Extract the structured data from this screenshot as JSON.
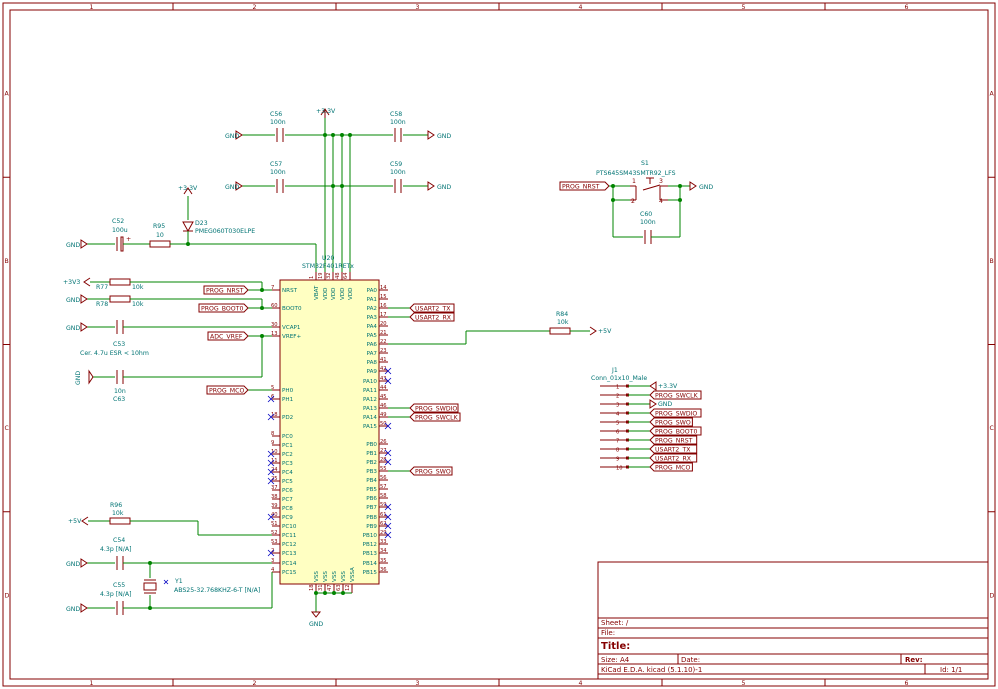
{
  "sheet": {
    "cols": [
      "1",
      "2",
      "3",
      "4",
      "5",
      "6"
    ],
    "rows": [
      "A",
      "B",
      "C",
      "D"
    ]
  },
  "title_block": {
    "sheet_label": "Sheet: /",
    "file_label": "File:",
    "title_label": "Title:",
    "size_label": "Size: A4",
    "date_label": "Date:",
    "rev_label": "Rev:",
    "tool_label": "KiCad E.D.A.  kicad (5.1.10)-1",
    "id_label": "Id: 1/1"
  },
  "mcu": {
    "ref": "U20",
    "value": "STM32F401RETx",
    "left_pins": [
      {
        "num": "7",
        "name": "NRST"
      },
      {
        "num": "60",
        "name": "BOOT0"
      },
      {
        "num": "30",
        "name": "VCAP1"
      },
      {
        "num": "13",
        "name": "VREF+"
      },
      {
        "num": "5",
        "name": "PH0"
      },
      {
        "num": "6",
        "name": "PH1"
      },
      {
        "num": "18",
        "name": "PD2"
      },
      {
        "num": "8",
        "name": "PC0"
      },
      {
        "num": "9",
        "name": "PC1"
      },
      {
        "num": "10",
        "name": "PC2"
      },
      {
        "num": "11",
        "name": "PC3"
      },
      {
        "num": "24",
        "name": "PC4"
      },
      {
        "num": "25",
        "name": "PC5"
      },
      {
        "num": "37",
        "name": "PC6"
      },
      {
        "num": "38",
        "name": "PC7"
      },
      {
        "num": "39",
        "name": "PC8"
      },
      {
        "num": "40",
        "name": "PC9"
      },
      {
        "num": "51",
        "name": "PC10"
      },
      {
        "num": "52",
        "name": "PC11"
      },
      {
        "num": "53",
        "name": "PC12"
      },
      {
        "num": "2",
        "name": "PC13"
      },
      {
        "num": "3",
        "name": "PC14"
      },
      {
        "num": "4",
        "name": "PC15"
      }
    ],
    "right_pins": [
      {
        "num": "14",
        "name": "PA0"
      },
      {
        "num": "15",
        "name": "PA1"
      },
      {
        "num": "16",
        "name": "PA2"
      },
      {
        "num": "17",
        "name": "PA3"
      },
      {
        "num": "20",
        "name": "PA4"
      },
      {
        "num": "21",
        "name": "PA5"
      },
      {
        "num": "22",
        "name": "PA6"
      },
      {
        "num": "23",
        "name": "PA7"
      },
      {
        "num": "41",
        "name": "PA8"
      },
      {
        "num": "42",
        "name": "PA9"
      },
      {
        "num": "43",
        "name": "PA10"
      },
      {
        "num": "44",
        "name": "PA11"
      },
      {
        "num": "45",
        "name": "PA12"
      },
      {
        "num": "46",
        "name": "PA13"
      },
      {
        "num": "49",
        "name": "PA14"
      },
      {
        "num": "50",
        "name": "PA15"
      },
      {
        "num": "26",
        "name": "PB0"
      },
      {
        "num": "27",
        "name": "PB1"
      },
      {
        "num": "28",
        "name": "PB2"
      },
      {
        "num": "55",
        "name": "PB3"
      },
      {
        "num": "56",
        "name": "PB4"
      },
      {
        "num": "57",
        "name": "PB5"
      },
      {
        "num": "58",
        "name": "PB6"
      },
      {
        "num": "59",
        "name": "PB7"
      },
      {
        "num": "61",
        "name": "PB8"
      },
      {
        "num": "62",
        "name": "PB9"
      },
      {
        "num": "29",
        "name": "PB10"
      },
      {
        "num": "33",
        "name": "PB12"
      },
      {
        "num": "34",
        "name": "PB13"
      },
      {
        "num": "35",
        "name": "PB14"
      },
      {
        "num": "36",
        "name": "PB15"
      }
    ],
    "top_pins": [
      {
        "num": "1",
        "name": "VBAT"
      },
      {
        "num": "19",
        "name": "VDD"
      },
      {
        "num": "32",
        "name": "VDD"
      },
      {
        "num": "48",
        "name": "VDD"
      },
      {
        "num": "64",
        "name": "VDD"
      }
    ],
    "bottom_pins": [
      {
        "num": "18",
        "name": "VSS"
      },
      {
        "num": "31",
        "name": "VSS"
      },
      {
        "num": "47",
        "name": "VSS"
      },
      {
        "num": "63",
        "name": "VSS"
      },
      {
        "num": "12",
        "name": "VSSA"
      }
    ]
  },
  "components": {
    "c56": {
      "ref": "C56",
      "val": "100n"
    },
    "c57": {
      "ref": "C57",
      "val": "100n"
    },
    "c58": {
      "ref": "C58",
      "val": "100n"
    },
    "c59": {
      "ref": "C59",
      "val": "100n"
    },
    "c52": {
      "ref": "C52",
      "val": "100u"
    },
    "r95": {
      "ref": "R95",
      "val": "10"
    },
    "d23": {
      "ref": "D23",
      "val": "PMEG060T030ELPE"
    },
    "r77": {
      "ref": "R77",
      "val": "10k"
    },
    "r78": {
      "ref": "R78",
      "val": "10k"
    },
    "c53": {
      "ref": "C53",
      "val": "Cer. 4.7u ESR < 10hm"
    },
    "c63": {
      "ref": "C63",
      "val": "10n"
    },
    "r96": {
      "ref": "R96",
      "val": "10k"
    },
    "c54": {
      "ref": "C54",
      "val": "4.3p [N/A]"
    },
    "c55": {
      "ref": "C55",
      "val": "4.3p [N/A]"
    },
    "y1": {
      "ref": "Y1",
      "val": "ABS25-32.768KHZ-6-T [N/A]"
    },
    "r84": {
      "ref": "R84",
      "val": "10k"
    },
    "s1": {
      "ref": "S1",
      "val": "PTS645SM43SMTR92_LFS"
    },
    "c60": {
      "ref": "C60",
      "val": "100n"
    },
    "j1": {
      "ref": "J1",
      "val": "Conn_01x10_Male"
    }
  },
  "power": {
    "gnd": "GND",
    "v33": "+3.3V",
    "v3v3": "+3V3",
    "v5": "+5V"
  },
  "labels": {
    "prog_nrst": "PROG_NRST",
    "prog_boot0": "PROG_BOOT0",
    "adc_vref": "ADC_VREF",
    "prog_mco": "PROG_MCO",
    "usart2_tx": "USART2_TX",
    "usart2_rx": "USART2_RX",
    "prog_swdio": "PROG_SWDIO",
    "prog_swclk": "PROG_SWCLK",
    "prog_swo": "PROG_SWO"
  },
  "connector": {
    "pins": [
      {
        "num": "1",
        "net": "+3.3V"
      },
      {
        "num": "2",
        "net": "PROG_SWCLK"
      },
      {
        "num": "3",
        "net": "GND"
      },
      {
        "num": "4",
        "net": "PROG_SWDIO"
      },
      {
        "num": "5",
        "net": "PROG_SWO"
      },
      {
        "num": "6",
        "net": "PROG_BOOT0"
      },
      {
        "num": "7",
        "net": "PROG_NRST"
      },
      {
        "num": "8",
        "net": "USART2_TX"
      },
      {
        "num": "9",
        "net": "USART2_RX"
      },
      {
        "num": "10",
        "net": "PROG_MCO"
      }
    ]
  },
  "switch_pins": {
    "p1": "1",
    "p2": "2",
    "p3": "3",
    "p4": "4"
  }
}
